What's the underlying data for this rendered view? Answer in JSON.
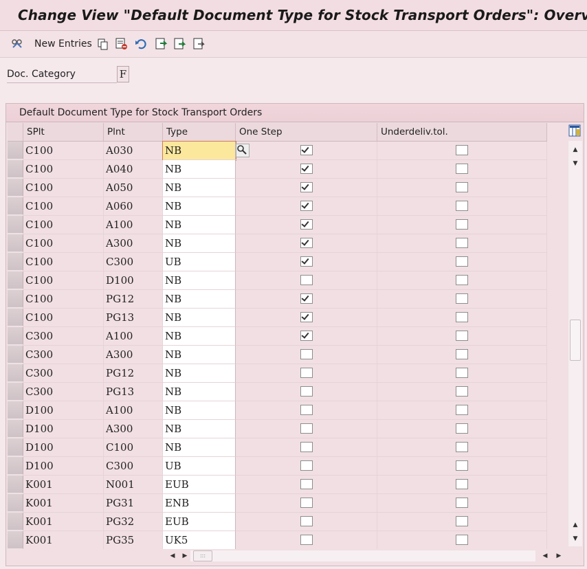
{
  "title": "Change View \"Default Document Type for Stock Transport Orders\": Overvi",
  "toolbar": {
    "new_entries_label": "New Entries",
    "icons": [
      "display-change-icon",
      "copy-icon",
      "delete-icon",
      "undo-icon",
      "select-all-icon",
      "select-block-icon",
      "deselect-all-icon"
    ]
  },
  "filter": {
    "label": "Doc. Category",
    "value": "F"
  },
  "table": {
    "title": "Default Document Type for Stock Transport Orders",
    "columns": [
      "SPlt",
      "Plnt",
      "Type",
      "One Step",
      "Underdeliv.tol."
    ],
    "rows": [
      {
        "splt": "C100",
        "plnt": "A030",
        "type": "NB",
        "one_step": true,
        "underdeliv": false
      },
      {
        "splt": "C100",
        "plnt": "A040",
        "type": "NB",
        "one_step": true,
        "underdeliv": false
      },
      {
        "splt": "C100",
        "plnt": "A050",
        "type": "NB",
        "one_step": true,
        "underdeliv": false
      },
      {
        "splt": "C100",
        "plnt": "A060",
        "type": "NB",
        "one_step": true,
        "underdeliv": false
      },
      {
        "splt": "C100",
        "plnt": "A100",
        "type": "NB",
        "one_step": true,
        "underdeliv": false
      },
      {
        "splt": "C100",
        "plnt": "A300",
        "type": "NB",
        "one_step": true,
        "underdeliv": false
      },
      {
        "splt": "C100",
        "plnt": "C300",
        "type": "UB",
        "one_step": true,
        "underdeliv": false
      },
      {
        "splt": "C100",
        "plnt": "D100",
        "type": "NB",
        "one_step": false,
        "underdeliv": false
      },
      {
        "splt": "C100",
        "plnt": "PG12",
        "type": "NB",
        "one_step": true,
        "underdeliv": false
      },
      {
        "splt": "C100",
        "plnt": "PG13",
        "type": "NB",
        "one_step": true,
        "underdeliv": false
      },
      {
        "splt": "C300",
        "plnt": "A100",
        "type": "NB",
        "one_step": true,
        "underdeliv": false
      },
      {
        "splt": "C300",
        "plnt": "A300",
        "type": "NB",
        "one_step": false,
        "underdeliv": false
      },
      {
        "splt": "C300",
        "plnt": "PG12",
        "type": "NB",
        "one_step": false,
        "underdeliv": false
      },
      {
        "splt": "C300",
        "plnt": "PG13",
        "type": "NB",
        "one_step": false,
        "underdeliv": false
      },
      {
        "splt": "D100",
        "plnt": "A100",
        "type": "NB",
        "one_step": false,
        "underdeliv": false
      },
      {
        "splt": "D100",
        "plnt": "A300",
        "type": "NB",
        "one_step": false,
        "underdeliv": false
      },
      {
        "splt": "D100",
        "plnt": "C100",
        "type": "NB",
        "one_step": false,
        "underdeliv": false
      },
      {
        "splt": "D100",
        "plnt": "C300",
        "type": "UB",
        "one_step": false,
        "underdeliv": false
      },
      {
        "splt": "K001",
        "plnt": "N001",
        "type": "EUB",
        "one_step": false,
        "underdeliv": false
      },
      {
        "splt": "K001",
        "plnt": "PG31",
        "type": "ENB",
        "one_step": false,
        "underdeliv": false
      },
      {
        "splt": "K001",
        "plnt": "PG32",
        "type": "EUB",
        "one_step": false,
        "underdeliv": false
      },
      {
        "splt": "K001",
        "plnt": "PG35",
        "type": "UK5",
        "one_step": false,
        "underdeliv": false
      }
    ]
  },
  "colors": {
    "background": "#f5e9ec",
    "accent": "#fbe89c"
  }
}
